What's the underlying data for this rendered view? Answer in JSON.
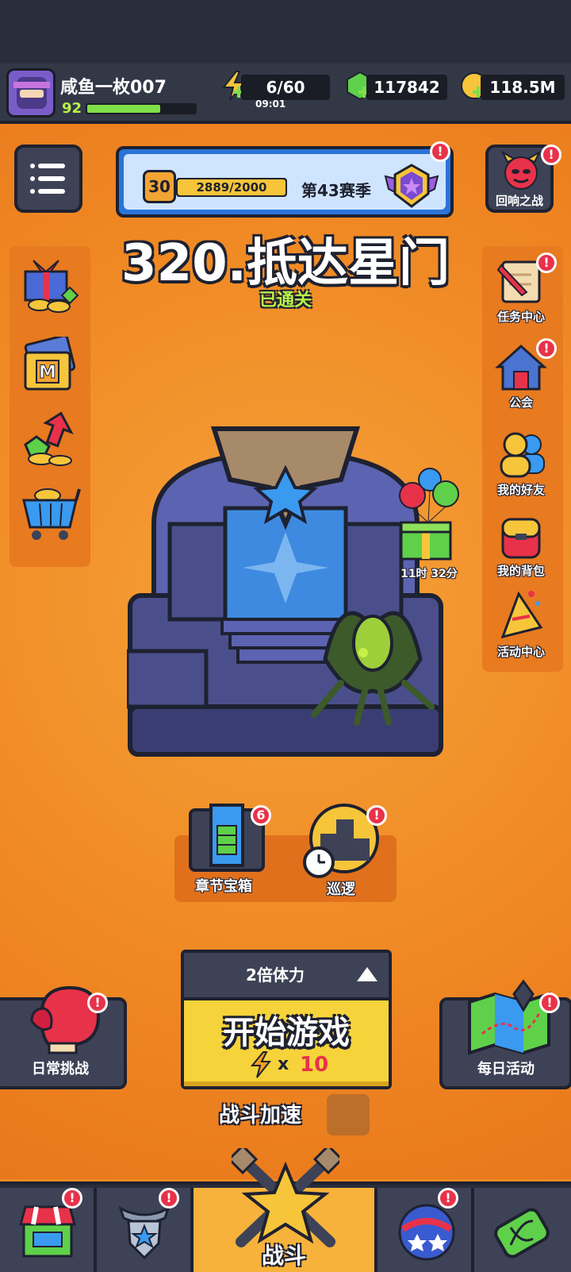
{
  "player": {
    "name": "咸鱼一枚007",
    "level": "92",
    "xp_fraction": 0.68
  },
  "resources": {
    "energy": "6/60",
    "energy_timer": "09:01",
    "gems": "117842",
    "coins": "118.5M"
  },
  "season": {
    "level": "30",
    "progress": "2889/2000",
    "progress_fraction": 1.0,
    "name": "第43赛季"
  },
  "stage": {
    "title": "320.抵达星门",
    "status": "已通关"
  },
  "right_menu": {
    "echo_battle": "回响之战",
    "tasks": "任务中心",
    "guild": "公会",
    "friends": "我的好友",
    "backpack": "我的背包",
    "events": "活动中心"
  },
  "gift_timer": "11时 32分",
  "mid_actions": {
    "chapter_chest": "章节宝箱",
    "chapter_chest_badge": "6",
    "patrol": "巡逻"
  },
  "start": {
    "mode": "2倍体力",
    "label": "开始游戏",
    "x": "x",
    "cost": "10"
  },
  "side_buttons": {
    "daily_challenge": "日常挑战",
    "daily_activity": "每日活动"
  },
  "battle_speed": "战斗加速",
  "nav": {
    "battle": "战斗"
  },
  "badges": {
    "alert": "!"
  },
  "colors": {
    "background": "#f08a24",
    "accent_yellow": "#f6d33a",
    "alert_red": "#e8324a",
    "status_green": "#b9f04a",
    "dark": "#1e2130"
  }
}
